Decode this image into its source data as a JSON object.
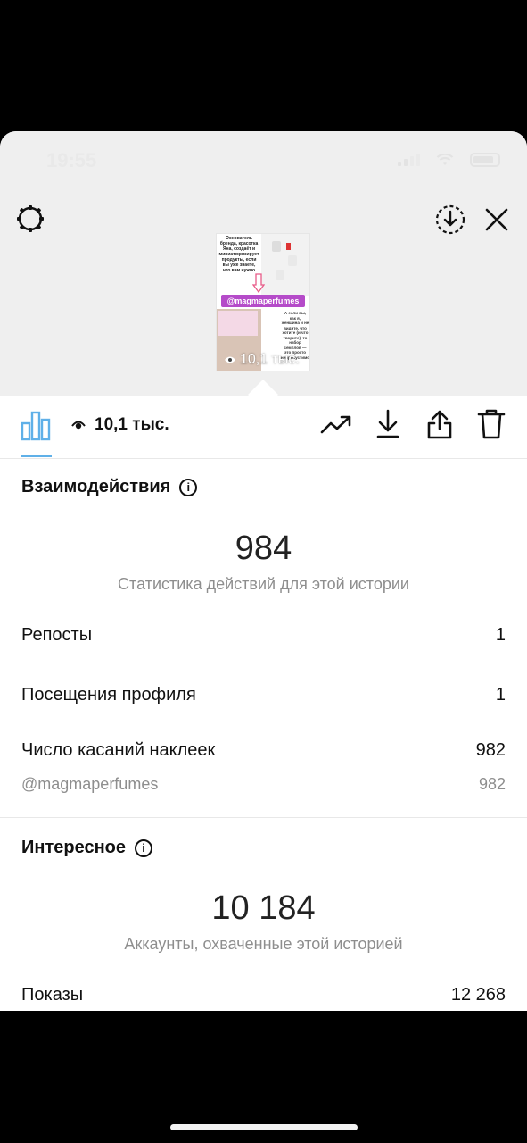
{
  "status_bar": {
    "time": "19:55"
  },
  "story_preview": {
    "text_left": "Основатель бренда, красотка Яна, создаёт и миниатюризирует продукты, если вы уже знаете, что вам нужно",
    "handle": "@magmaperfumes",
    "text_right": "А если вы, как я, женщина и не видите, что хотите (и что творите), то набор семплов — это просто непропустимо",
    "views": "10,1 тыс."
  },
  "toolbar": {
    "views": "10,1 тыс."
  },
  "interactions": {
    "title": "Взаимодействия",
    "total": "984",
    "total_caption": "Статистика действий для этой истории",
    "rows": [
      {
        "label": "Репосты",
        "value": "1"
      },
      {
        "label": "Посещения профиля",
        "value": "1"
      },
      {
        "label": "Число касаний наклеек",
        "value": "982"
      }
    ],
    "sticker_detail": {
      "label": "@magmaperfumes",
      "value": "982"
    }
  },
  "discovery": {
    "title": "Интересное",
    "total": "10 184",
    "total_caption": "Аккаунты, охваченные этой историей",
    "rows": [
      {
        "label": "Показы",
        "value": "12 268"
      }
    ]
  },
  "icons": {
    "settings": "gear-icon",
    "download_circle": "download-circle-icon",
    "close": "close-icon",
    "insights": "bar-chart-icon",
    "eye": "eye-icon",
    "trend": "trending-up-icon",
    "download": "download-icon",
    "share": "share-icon",
    "delete": "trash-icon",
    "info": "info-icon"
  },
  "colors": {
    "accent": "#5fb0e8",
    "handle_bg": "#b54bc9",
    "muted_text": "#8e8e8e"
  }
}
